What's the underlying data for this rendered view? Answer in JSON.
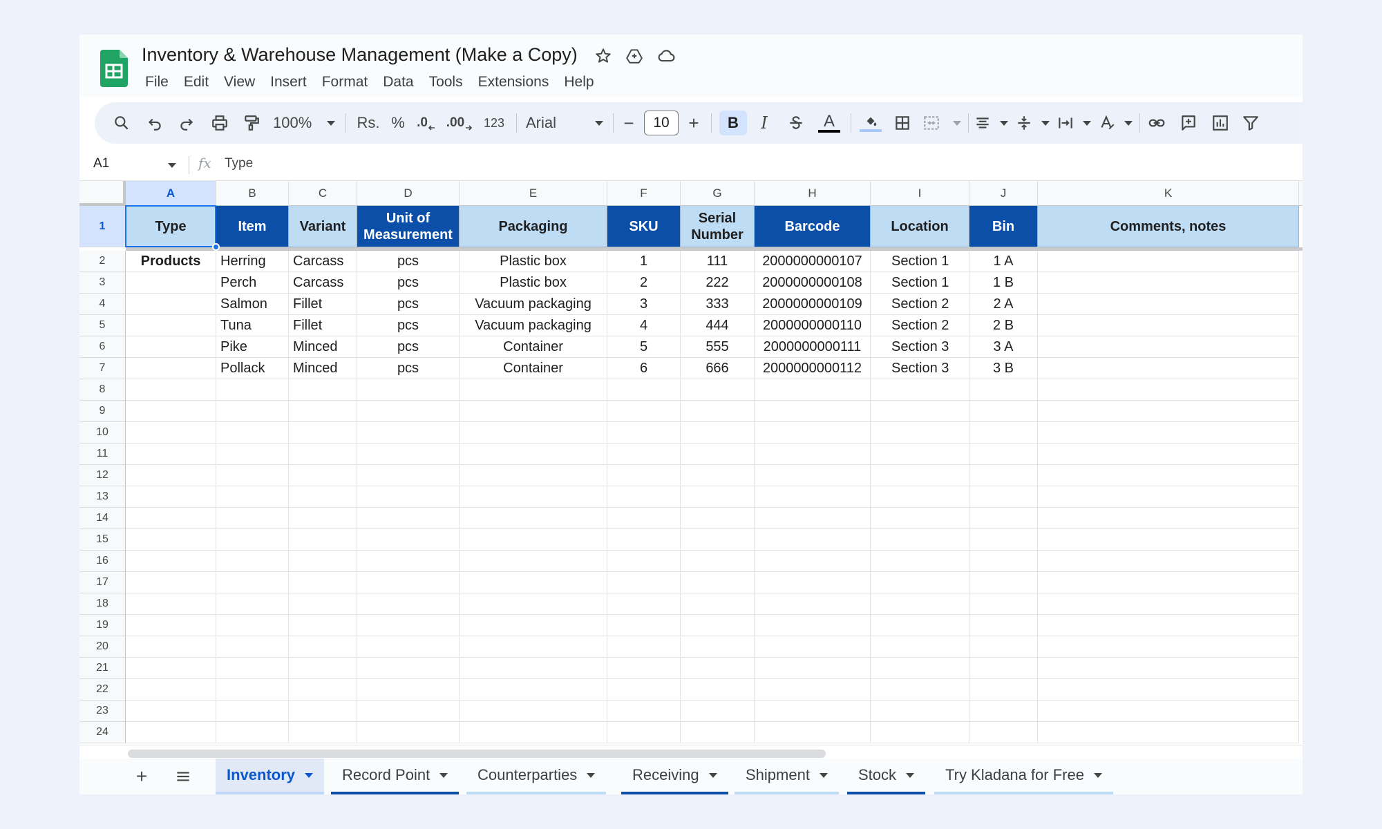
{
  "document": {
    "title": "Inventory & Warehouse Management (Make a Copy)",
    "menu": [
      "File",
      "Edit",
      "View",
      "Insert",
      "Format",
      "Data",
      "Tools",
      "Extensions",
      "Help"
    ]
  },
  "toolbar": {
    "zoom": "100%",
    "currency": "Rs.",
    "percent": "%",
    "decrease_decimal": ".0",
    "increase_decimal": ".00",
    "number_format": "123",
    "font": "Arial",
    "font_size": "10",
    "minus": "−",
    "plus": "+",
    "bold": "B",
    "italic": "I",
    "text_color_glyph": "A",
    "text_color": "#000000",
    "fill_color": "#a8c7fa"
  },
  "formula_bar": {
    "cell_ref": "A1",
    "fx": "fx",
    "value": "Type"
  },
  "grid": {
    "columns": [
      "A",
      "B",
      "C",
      "D",
      "E",
      "F",
      "G",
      "H",
      "I",
      "J",
      "K"
    ],
    "selected_column": "A",
    "row_numbers": [
      "1",
      "2",
      "3",
      "4",
      "5",
      "6",
      "7",
      "8",
      "9",
      "10",
      "11",
      "12",
      "13",
      "14",
      "15",
      "16",
      "17",
      "18",
      "19",
      "20",
      "21",
      "22",
      "23",
      "24"
    ],
    "header_row": [
      "Type",
      "Item",
      "Variant",
      "Unit of Measurement",
      "Packaging",
      "SKU",
      "Serial Number",
      "Barcode",
      "Location",
      "Bin",
      "Comments, notes"
    ],
    "header_colors": {
      "dark": "#0b4fa8",
      "light": "#bfdcf5"
    },
    "rows": [
      [
        "Products",
        "Herring",
        "Carcass",
        "pcs",
        "Plastic box",
        "1",
        "111",
        "2000000000107",
        "Section 1",
        "1 A",
        ""
      ],
      [
        "",
        "Perch",
        "Carcass",
        "pcs",
        "Plastic box",
        "2",
        "222",
        "2000000000108",
        "Section 1",
        "1 B",
        ""
      ],
      [
        "",
        "Salmon",
        "Fillet",
        "pcs",
        "Vacuum packaging",
        "3",
        "333",
        "2000000000109",
        "Section 2",
        "2 A",
        ""
      ],
      [
        "",
        "Tuna",
        "Fillet",
        "pcs",
        "Vacuum packaging",
        "4",
        "444",
        "2000000000110",
        "Section 2",
        "2 B",
        ""
      ],
      [
        "",
        "Pike",
        "Minced",
        "pcs",
        "Container",
        "5",
        "555",
        "2000000000111",
        "Section 3",
        "3 A",
        ""
      ],
      [
        "",
        "Pollack",
        "Minced",
        "pcs",
        "Container",
        "6",
        "666",
        "2000000000112",
        "Section 3",
        "3 B",
        ""
      ]
    ]
  },
  "sheets": {
    "add": "+",
    "tabs": [
      "Inventory",
      "Record Point",
      "Counterparties",
      "Receiving",
      "Shipment",
      "Stock",
      "Try Kladana for Free"
    ],
    "active": "Inventory"
  }
}
